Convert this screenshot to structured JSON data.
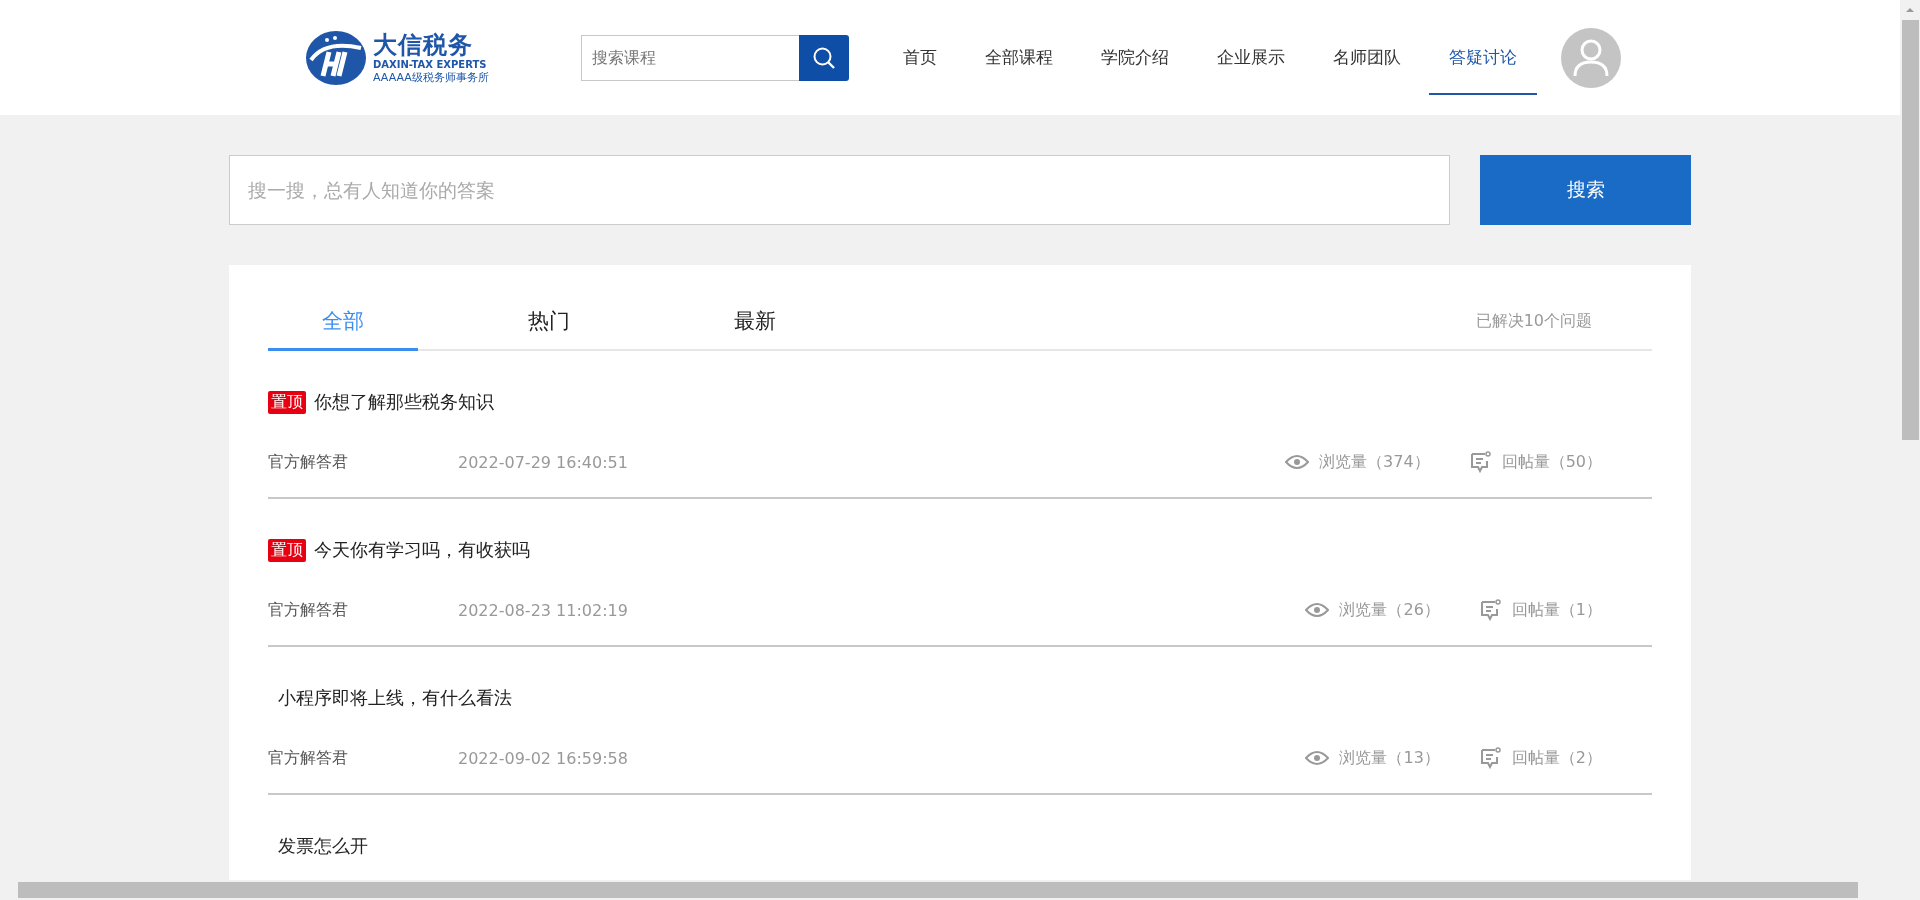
{
  "header": {
    "logo": {
      "name": "大信税务",
      "subtitle": "DAXIN-TAX EXPERTS",
      "tagline": "AAAAA级税务师事务所"
    },
    "course_search": {
      "placeholder": "搜索课程"
    },
    "nav": [
      {
        "label": "首页",
        "selected": false
      },
      {
        "label": "全部课程",
        "selected": false
      },
      {
        "label": "学院介绍",
        "selected": false
      },
      {
        "label": "企业展示",
        "selected": false
      },
      {
        "label": "名师团队",
        "selected": false
      },
      {
        "label": "答疑讨论",
        "selected": true
      }
    ]
  },
  "question_search": {
    "placeholder": "搜一搜，总有人知道你的答案",
    "button": "搜索"
  },
  "tabs": [
    {
      "label": "全部",
      "selected": true
    },
    {
      "label": "热门",
      "selected": false
    },
    {
      "label": "最新",
      "selected": false
    }
  ],
  "solved_count": "已解决10个问题",
  "questions": [
    {
      "badge": "置顶",
      "title": "你想了解那些税务知识",
      "author": "官方解答君",
      "time": "2022-07-29 16:40:51",
      "views": "浏览量（374）",
      "replies": "回帖量（50）"
    },
    {
      "badge": "置顶",
      "title": "今天你有学习吗，有收获吗",
      "author": "官方解答君",
      "time": "2022-08-23 11:02:19",
      "views": "浏览量（26）",
      "replies": "回帖量（1）"
    },
    {
      "title": "小程序即将上线，有什么看法",
      "author": "官方解答君",
      "time": "2022-09-02 16:59:58",
      "views": "浏览量（13）",
      "replies": "回帖量（2）"
    },
    {
      "title": "发票怎么开"
    }
  ]
}
